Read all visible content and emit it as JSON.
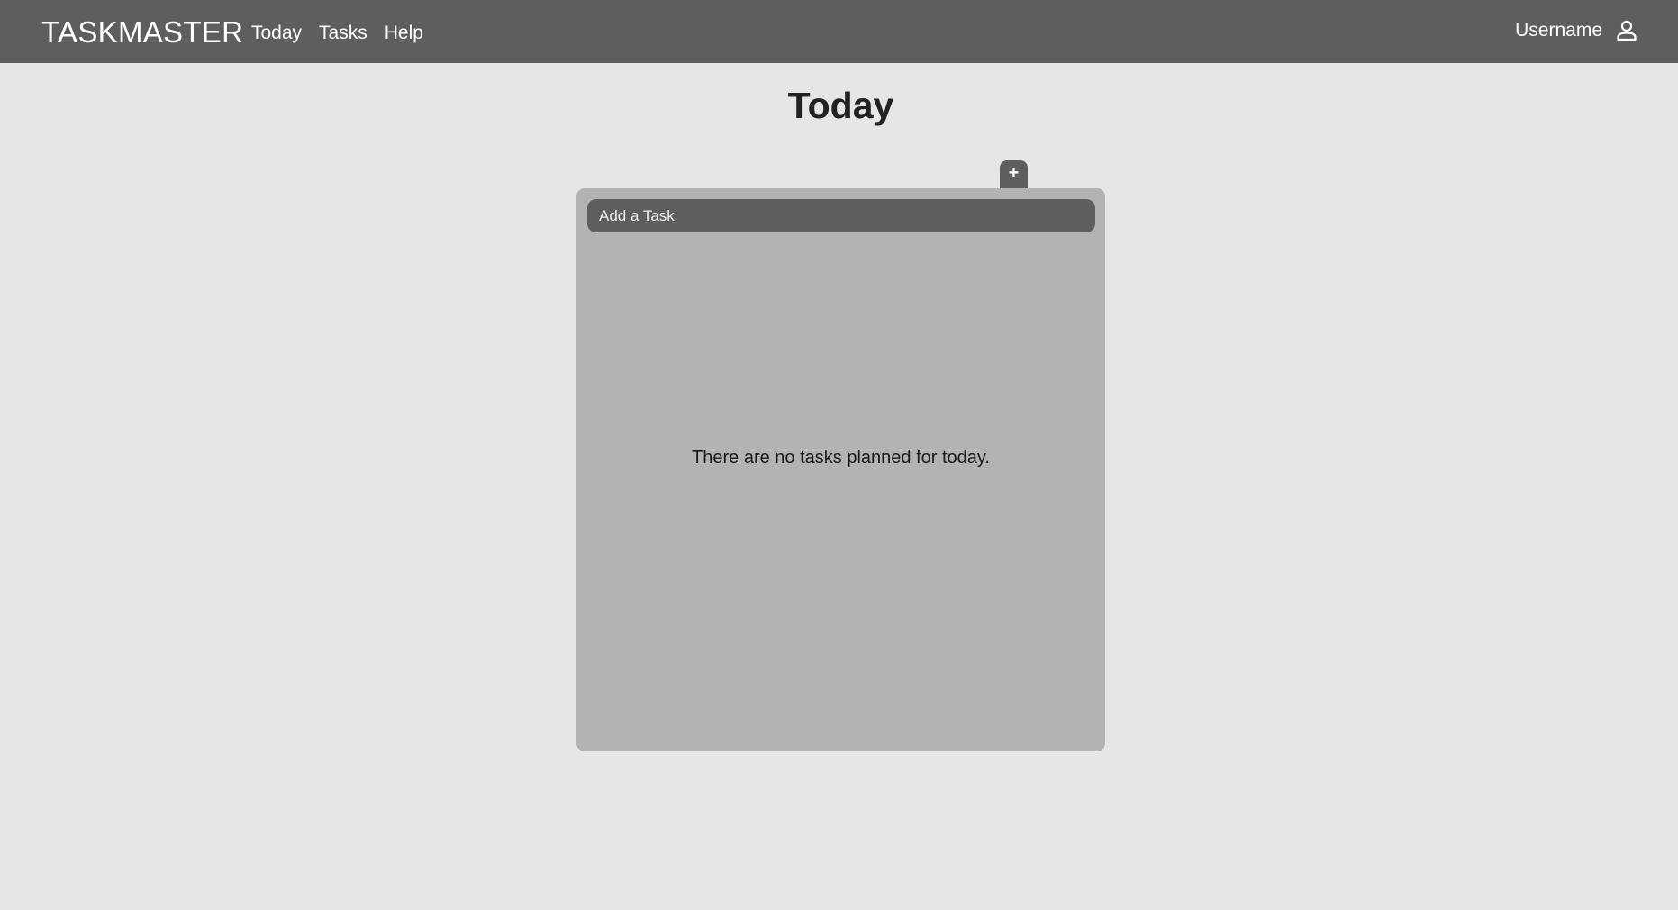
{
  "navbar": {
    "brand": "TASKMASTER",
    "links": [
      {
        "label": "Today"
      },
      {
        "label": "Tasks"
      },
      {
        "label": "Help"
      }
    ],
    "user": {
      "name": "Username",
      "icon": "user-icon"
    }
  },
  "main": {
    "title": "Today",
    "add_tab_label": "+",
    "add_task_placeholder": "Add a Task",
    "empty_message": "There are no tasks planned for today."
  },
  "colors": {
    "navbar_bg": "#5e5e5e",
    "page_bg": "#e6e6e6",
    "panel_bg": "#b3b3b3",
    "input_bg": "#5e5e5e"
  }
}
